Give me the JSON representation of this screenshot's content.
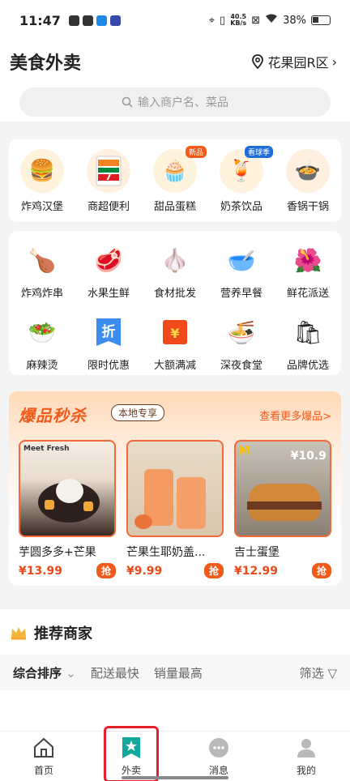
{
  "status": {
    "time": "11:47",
    "speed": "40.5",
    "speed_unit": "KB/s",
    "battery": "38%"
  },
  "header": {
    "title": "美食外卖",
    "location": "花果园R区",
    "search_placeholder": "输入商户名、菜品"
  },
  "categories_top": [
    {
      "label": "炸鸡汉堡",
      "icon": "burger-icon",
      "badge": ""
    },
    {
      "label": "商超便利",
      "icon": "seven-eleven-icon",
      "badge": ""
    },
    {
      "label": "甜品蛋糕",
      "icon": "cupcake-icon",
      "badge": "新品"
    },
    {
      "label": "奶茶饮品",
      "icon": "milk-tea-icon",
      "badge": "看球季"
    },
    {
      "label": "香锅干锅",
      "icon": "hot-pot-icon",
      "badge": ""
    }
  ],
  "categories_more": [
    {
      "label": "炸鸡炸串",
      "icon": "fried-chicken-icon"
    },
    {
      "label": "水果生鲜",
      "icon": "meat-icon"
    },
    {
      "label": "食材批发",
      "icon": "scallion-icon"
    },
    {
      "label": "营养早餐",
      "icon": "porridge-icon"
    },
    {
      "label": "鲜花派送",
      "icon": "flower-icon"
    },
    {
      "label": "麻辣烫",
      "icon": "spicy-bowl-icon"
    },
    {
      "label": "限时优惠",
      "icon": "discount-icon"
    },
    {
      "label": "大额满减",
      "icon": "red-envelope-icon"
    },
    {
      "label": "深夜食堂",
      "icon": "noodle-icon"
    },
    {
      "label": "品牌优选",
      "icon": "shopping-bag-icon"
    }
  ],
  "flash_sale": {
    "title": "爆品秒杀",
    "tag": "本地专享",
    "more": "查看更多爆品>",
    "grab_label": "抢",
    "products": [
      {
        "name": "芋圆多多+芒果",
        "price": "¥13.99",
        "brand": "Meet Fresh"
      },
      {
        "name": "芒果生耶奶盖...",
        "price": "¥9.99",
        "brand": ""
      },
      {
        "name": "吉士蛋堡",
        "price": "¥12.99",
        "brand": "¥10.9"
      }
    ]
  },
  "recommend": {
    "title": "推荐商家",
    "sorts": [
      "综合排序",
      "配送最快",
      "销量最高"
    ],
    "filter": "筛选"
  },
  "nav": [
    {
      "label": "首页",
      "icon": "home-icon"
    },
    {
      "label": "外卖",
      "icon": "takeout-icon"
    },
    {
      "label": "消息",
      "icon": "message-icon"
    },
    {
      "label": "我的",
      "icon": "profile-icon"
    }
  ],
  "colors": {
    "accent": "#f25a1a",
    "price": "#e84a1a",
    "highlight": "#e5202a",
    "takeout_icon": "#12a89b"
  }
}
